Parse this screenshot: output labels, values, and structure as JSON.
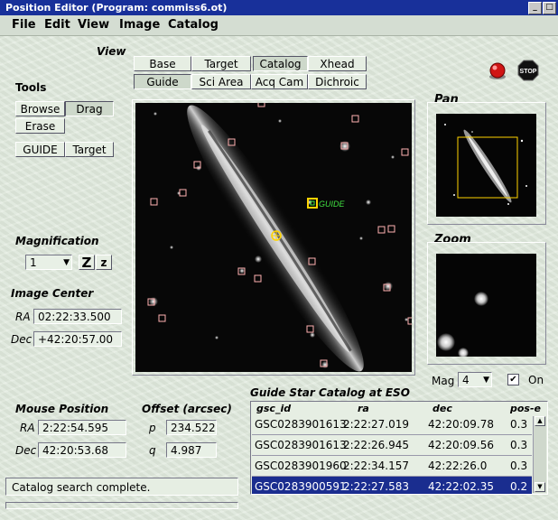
{
  "window": {
    "title": "Position Editor (Program: commiss6.ot)"
  },
  "menu": [
    "File",
    "Edit",
    "View",
    "Image",
    "Catalog"
  ],
  "view": {
    "label": "View",
    "buttons": [
      "Base",
      "Target",
      "Catalog",
      "Xhead",
      "Guide",
      "Sci Area",
      "Acq Cam",
      "Dichroic"
    ]
  },
  "tools": {
    "label": "Tools",
    "browse": "Browse",
    "drag": "Drag",
    "erase": "Erase",
    "guide": "GUIDE",
    "target": "Target"
  },
  "magnification": {
    "label": "Magnification",
    "value": "1",
    "zoom_in": "Z",
    "zoom_out": "z"
  },
  "image_center": {
    "label": "Image Center",
    "ra_label": "RA",
    "ra": "02:22:33.500",
    "dec_label": "Dec",
    "dec": "+42:20:57.00"
  },
  "mouse_position": {
    "label": "Mouse Position",
    "ra_label": "RA",
    "ra": "2:22:54.595",
    "dec_label": "Dec",
    "dec": "42:20:53.68"
  },
  "offset": {
    "label": "Offset (arcsec)",
    "p_label": "p",
    "p": "234.522",
    "q_label": "q",
    "q": "4.987"
  },
  "image": {
    "guide_tag": "GUIDE"
  },
  "pan": {
    "label": "Pan"
  },
  "zoom": {
    "label": "Zoom",
    "mag_label": "Mag",
    "mag_value": "4",
    "on_label": "On",
    "on_checked": true
  },
  "catalog": {
    "title": "Guide Star Catalog at ESO",
    "columns": [
      "gsc_id",
      "ra",
      "dec",
      "pos-e"
    ],
    "rows": [
      [
        "GSC0283901613",
        "2:22:27.019",
        "42:20:09.78",
        "0.3"
      ],
      [
        "GSC0283901613",
        "2:22:26.945",
        "42:20:09.56",
        "0.3"
      ],
      [
        "GSC0283901960",
        "2:22:34.157",
        "42:22:26.0",
        "0.3"
      ],
      [
        "GSC0283900591",
        "2:22:27.583",
        "42:22:02.35",
        "0.2"
      ]
    ],
    "selected_row": 3
  },
  "status": {
    "message": "Catalog search complete."
  },
  "stop_label": "STOP",
  "colors": {
    "titlebar": "#18309a",
    "selection": "#1a2d8f",
    "guide_marker": "#ffd400",
    "guide_text": "#40e040",
    "star_box": "#ffb0b0"
  }
}
